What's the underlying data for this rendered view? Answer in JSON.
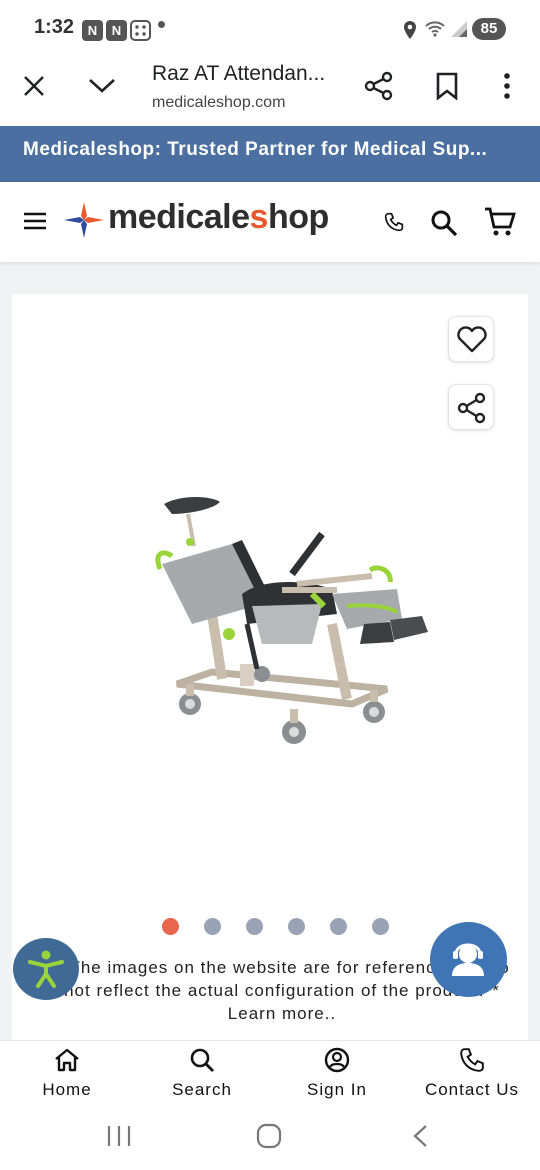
{
  "status_bar": {
    "time": "1:32",
    "battery": "85",
    "icons": [
      "notification-n-icon",
      "notification-n-icon",
      "dice-icon",
      "location-icon",
      "wifi-icon",
      "signal-icon"
    ]
  },
  "browser": {
    "page_title": "Raz AT Attendan...",
    "domain": "medicaleshop.com",
    "icons": [
      "close-icon",
      "chevron-down-icon",
      "share-icon",
      "bookmark-icon",
      "more-vert-icon"
    ]
  },
  "banner": {
    "text": "Medicaleshop: Trusted Partner for Medical Sup..."
  },
  "site_header": {
    "logo_main": "medicale",
    "logo_accent": "s",
    "logo_end": "hop",
    "icons": [
      "menu-icon",
      "phone-icon",
      "search-icon",
      "cart-icon"
    ]
  },
  "product": {
    "image_alt": "Raz AT attendant tilt shower commode chair",
    "image_count": 6,
    "active_image_index": 0,
    "disclaimer": "**The images on the website are for reference and do not reflect the actual configuration of the product.** Learn more.."
  },
  "bottom_nav": {
    "items": [
      {
        "label": "Home",
        "icon": "home-icon"
      },
      {
        "label": "Search",
        "icon": "search-icon"
      },
      {
        "label": "Sign In",
        "icon": "user-circle-icon"
      },
      {
        "label": "Contact Us",
        "icon": "phone-icon"
      }
    ]
  },
  "colors": {
    "banner_bg": "#4a6fa0",
    "accent_orange": "#e8582a",
    "dot_active": "#e8664d",
    "dot_inactive": "#9aa2b5",
    "accessibility_bg": "#3f6a95",
    "support_bg": "#3f74b5"
  }
}
